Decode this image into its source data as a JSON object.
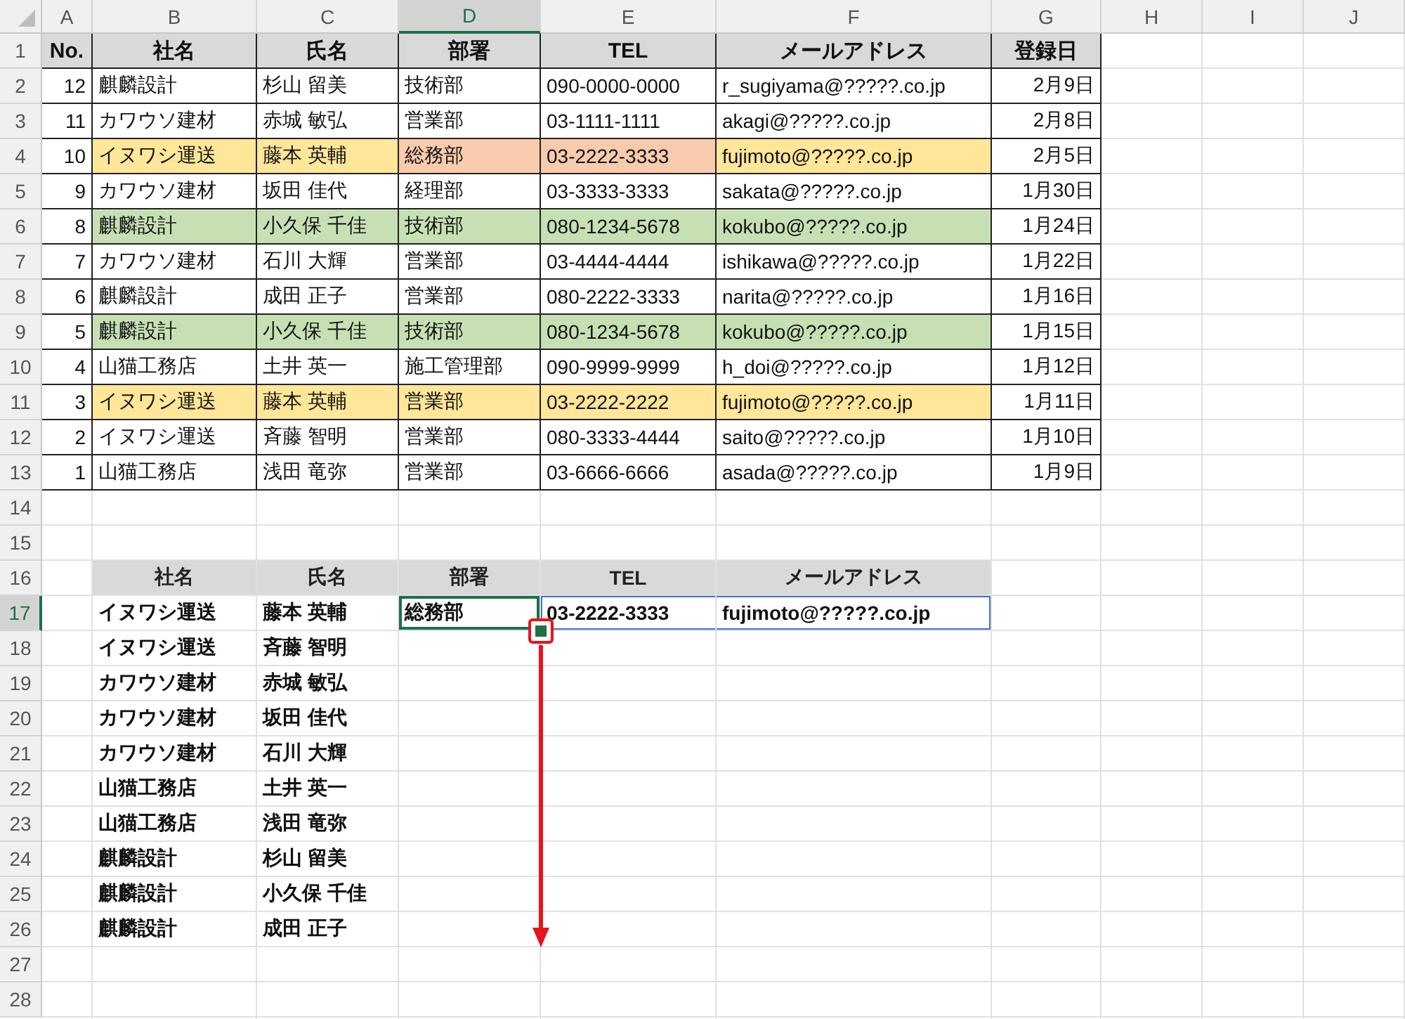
{
  "column_headers": [
    {
      "label": "A",
      "selected": false
    },
    {
      "label": "B",
      "selected": false
    },
    {
      "label": "C",
      "selected": false
    },
    {
      "label": "D",
      "selected": true
    },
    {
      "label": "E",
      "selected": false
    },
    {
      "label": "F",
      "selected": false
    },
    {
      "label": "G",
      "selected": false
    },
    {
      "label": "H",
      "selected": false
    },
    {
      "label": "I",
      "selected": false
    },
    {
      "label": "J",
      "selected": false
    }
  ],
  "row_headers": [
    {
      "label": "1",
      "selected": false
    },
    {
      "label": "2",
      "selected": false
    },
    {
      "label": "3",
      "selected": false
    },
    {
      "label": "4",
      "selected": false
    },
    {
      "label": "5",
      "selected": false
    },
    {
      "label": "6",
      "selected": false
    },
    {
      "label": "7",
      "selected": false
    },
    {
      "label": "8",
      "selected": false
    },
    {
      "label": "9",
      "selected": false
    },
    {
      "label": "10",
      "selected": false
    },
    {
      "label": "11",
      "selected": false
    },
    {
      "label": "12",
      "selected": false
    },
    {
      "label": "13",
      "selected": false
    },
    {
      "label": "14",
      "selected": false
    },
    {
      "label": "15",
      "selected": false
    },
    {
      "label": "16",
      "selected": false
    },
    {
      "label": "17",
      "selected": true
    },
    {
      "label": "18",
      "selected": false
    },
    {
      "label": "19",
      "selected": false
    },
    {
      "label": "20",
      "selected": false
    },
    {
      "label": "21",
      "selected": false
    },
    {
      "label": "22",
      "selected": false
    },
    {
      "label": "23",
      "selected": false
    },
    {
      "label": "24",
      "selected": false
    },
    {
      "label": "25",
      "selected": false
    },
    {
      "label": "26",
      "selected": false
    },
    {
      "label": "27",
      "selected": false
    },
    {
      "label": "28",
      "selected": false
    }
  ],
  "table_1": {
    "columns": [
      "No.",
      "社名",
      "氏名",
      "部署",
      "TEL",
      "メールアドレス",
      "登録日"
    ],
    "rows": [
      {
        "cells": [
          {
            "text": "12"
          },
          {
            "text": "麒麟設計"
          },
          {
            "text": "杉山 留美"
          },
          {
            "text": "技術部"
          },
          {
            "text": "090-0000-0000"
          },
          {
            "text": "r_sugiyama@?????.co.jp"
          },
          {
            "text": "2月9日"
          }
        ]
      },
      {
        "cells": [
          {
            "text": "11"
          },
          {
            "text": "カワウソ建材"
          },
          {
            "text": "赤城 敏弘"
          },
          {
            "text": "営業部"
          },
          {
            "text": "03-1111-1111"
          },
          {
            "text": "akagi@?????.co.jp"
          },
          {
            "text": "2月8日"
          }
        ]
      },
      {
        "cells": [
          {
            "text": "10"
          },
          {
            "text": "イヌワシ運送",
            "color": "#ffe699"
          },
          {
            "text": "藤本 英輔",
            "color": "#ffe699"
          },
          {
            "text": "総務部",
            "color": "#f8cbad"
          },
          {
            "text": "03-2222-3333",
            "color": "#f8cbad"
          },
          {
            "text": "fujimoto@?????.co.jp",
            "color": "#ffe699"
          },
          {
            "text": "2月5日"
          }
        ]
      },
      {
        "cells": [
          {
            "text": "9"
          },
          {
            "text": "カワウソ建材"
          },
          {
            "text": "坂田 佳代"
          },
          {
            "text": "経理部"
          },
          {
            "text": "03-3333-3333"
          },
          {
            "text": "sakata@?????.co.jp"
          },
          {
            "text": "1月30日"
          }
        ]
      },
      {
        "cells": [
          {
            "text": "8"
          },
          {
            "text": "麒麟設計",
            "color": "#c6e0b4"
          },
          {
            "text": "小久保 千佳",
            "color": "#c6e0b4"
          },
          {
            "text": "技術部",
            "color": "#c6e0b4"
          },
          {
            "text": "080-1234-5678",
            "color": "#c6e0b4"
          },
          {
            "text": "kokubo@?????.co.jp",
            "color": "#c6e0b4"
          },
          {
            "text": "1月24日"
          }
        ]
      },
      {
        "cells": [
          {
            "text": "7"
          },
          {
            "text": "カワウソ建材"
          },
          {
            "text": "石川 大輝"
          },
          {
            "text": "営業部"
          },
          {
            "text": "03-4444-4444"
          },
          {
            "text": "ishikawa@?????.co.jp"
          },
          {
            "text": "1月22日"
          }
        ]
      },
      {
        "cells": [
          {
            "text": "6"
          },
          {
            "text": "麒麟設計"
          },
          {
            "text": "成田 正子"
          },
          {
            "text": "営業部"
          },
          {
            "text": "080-2222-3333"
          },
          {
            "text": "narita@?????.co.jp"
          },
          {
            "text": "1月16日"
          }
        ]
      },
      {
        "cells": [
          {
            "text": "5"
          },
          {
            "text": "麒麟設計",
            "color": "#c6e0b4"
          },
          {
            "text": "小久保 千佳",
            "color": "#c6e0b4"
          },
          {
            "text": "技術部",
            "color": "#c6e0b4"
          },
          {
            "text": "080-1234-5678",
            "color": "#c6e0b4"
          },
          {
            "text": "kokubo@?????.co.jp",
            "color": "#c6e0b4"
          },
          {
            "text": "1月15日"
          }
        ]
      },
      {
        "cells": [
          {
            "text": "4"
          },
          {
            "text": "山猫工務店"
          },
          {
            "text": "土井 英一"
          },
          {
            "text": "施工管理部"
          },
          {
            "text": "090-9999-9999"
          },
          {
            "text": "h_doi@?????.co.jp"
          },
          {
            "text": "1月12日"
          }
        ]
      },
      {
        "cells": [
          {
            "text": "3"
          },
          {
            "text": "イヌワシ運送",
            "color": "#ffe699"
          },
          {
            "text": "藤本 英輔",
            "color": "#ffe699"
          },
          {
            "text": "営業部",
            "color": "#ffe699"
          },
          {
            "text": "03-2222-2222",
            "color": "#ffe699"
          },
          {
            "text": "fujimoto@?????.co.jp",
            "color": "#ffe699"
          },
          {
            "text": "1月11日"
          }
        ]
      },
      {
        "cells": [
          {
            "text": "2"
          },
          {
            "text": "イヌワシ運送"
          },
          {
            "text": "斉藤 智明"
          },
          {
            "text": "営業部"
          },
          {
            "text": "080-3333-4444"
          },
          {
            "text": "saito@?????.co.jp"
          },
          {
            "text": "1月10日"
          }
        ]
      },
      {
        "cells": [
          {
            "text": "1"
          },
          {
            "text": "山猫工務店"
          },
          {
            "text": "浅田 竜弥"
          },
          {
            "text": "営業部"
          },
          {
            "text": "03-6666-6666"
          },
          {
            "text": "asada@?????.co.jp"
          },
          {
            "text": "1月9日"
          }
        ]
      }
    ]
  },
  "table_2": {
    "columns": [
      "社名",
      "氏名",
      "部署",
      "TEL",
      "メールアドレス"
    ],
    "rows": [
      {
        "cells": [
          {
            "text": "イヌワシ運送",
            "highlighted": false
          },
          {
            "text": "藤本 英輔",
            "highlighted": false
          },
          {
            "text": "総務部",
            "highlighted": false
          },
          {
            "text": "03-2222-3333",
            "highlighted": true
          },
          {
            "text": "fujimoto@?????.co.jp",
            "highlighted": true
          }
        ]
      },
      {
        "cells": [
          {
            "text": "イヌワシ運送",
            "highlighted": false
          },
          {
            "text": "斉藤 智明",
            "highlighted": false
          }
        ]
      },
      {
        "cells": [
          {
            "text": "カワウソ建材",
            "highlighted": false
          },
          {
            "text": "赤城 敏弘",
            "highlighted": false
          }
        ]
      },
      {
        "cells": [
          {
            "text": "カワウソ建材",
            "highlighted": false
          },
          {
            "text": "坂田 佳代",
            "highlighted": false
          }
        ]
      },
      {
        "cells": [
          {
            "text": "カワウソ建材",
            "highlighted": false
          },
          {
            "text": "石川 大輝",
            "highlighted": false
          }
        ]
      },
      {
        "cells": [
          {
            "text": "山猫工務店",
            "highlighted": false
          },
          {
            "text": "土井 英一",
            "highlighted": false
          }
        ]
      },
      {
        "cells": [
          {
            "text": "山猫工務店",
            "highlighted": false
          },
          {
            "text": "浅田 竜弥",
            "highlighted": false
          }
        ]
      },
      {
        "cells": [
          {
            "text": "麒麟設計",
            "highlighted": false
          },
          {
            "text": "杉山 留美",
            "highlighted": false
          }
        ]
      },
      {
        "cells": [
          {
            "text": "麒麟設計",
            "highlighted": false
          },
          {
            "text": "小久保 千佳",
            "highlighted": false
          }
        ]
      },
      {
        "cells": [
          {
            "text": "麒麟設計",
            "highlighted": false
          },
          {
            "text": "成田 正子",
            "highlighted": false
          }
        ]
      }
    ]
  }
}
